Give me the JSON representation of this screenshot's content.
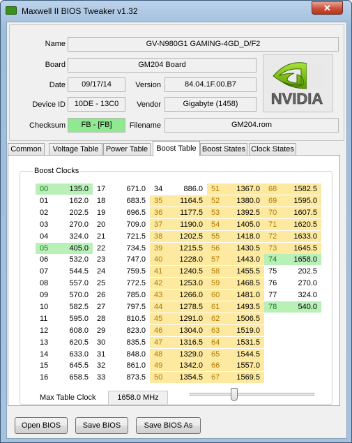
{
  "window": {
    "title": "Maxwell II BIOS Tweaker v1.32",
    "close_label": "✕"
  },
  "info": {
    "name_label": "Name",
    "name_value": "GV-N980G1 GAMING-4GD_D/F2",
    "board_label": "Board",
    "board_value": "GM204 Board",
    "date_label": "Date",
    "date_value": "09/17/14",
    "version_label": "Version",
    "version_value": "84.04.1F.00.B7",
    "device_label": "Device ID",
    "device_value": "10DE - 13C0",
    "vendor_label": "Vendor",
    "vendor_value": "Gigabyte (1458)",
    "checksum_label": "Checksum",
    "checksum_value": "FB - [FB]",
    "filename_label": "Filename",
    "filename_value": "GM204.rom",
    "logo_text": "NVIDIA",
    "colors": {
      "checksum_ok": "#90e890",
      "nvidia_green": "#76b900"
    }
  },
  "tabs": [
    {
      "label": "Common"
    },
    {
      "label": "Voltage Table"
    },
    {
      "label": "Power Table"
    },
    {
      "label": "Boost Table",
      "active": true
    },
    {
      "label": "Boost States"
    },
    {
      "label": "Clock States"
    }
  ],
  "boost": {
    "group_label": "Boost Clocks",
    "columns": [
      [
        [
          "00",
          "135.0",
          "g"
        ],
        [
          "01",
          "162.0",
          ""
        ],
        [
          "02",
          "202.5",
          ""
        ],
        [
          "03",
          "270.0",
          ""
        ],
        [
          "04",
          "324.0",
          ""
        ],
        [
          "05",
          "405.0",
          "g"
        ],
        [
          "06",
          "532.0",
          ""
        ],
        [
          "07",
          "544.5",
          ""
        ],
        [
          "08",
          "557.0",
          ""
        ],
        [
          "09",
          "570.0",
          ""
        ],
        [
          "10",
          "582.5",
          ""
        ],
        [
          "11",
          "595.0",
          ""
        ],
        [
          "12",
          "608.0",
          ""
        ],
        [
          "13",
          "620.5",
          ""
        ],
        [
          "14",
          "633.0",
          ""
        ],
        [
          "15",
          "645.5",
          ""
        ],
        [
          "16",
          "658.5",
          ""
        ]
      ],
      [
        [
          "17",
          "671.0",
          ""
        ],
        [
          "18",
          "683.5",
          ""
        ],
        [
          "19",
          "696.5",
          ""
        ],
        [
          "20",
          "709.0",
          ""
        ],
        [
          "21",
          "721.5",
          ""
        ],
        [
          "22",
          "734.5",
          ""
        ],
        [
          "23",
          "747.0",
          ""
        ],
        [
          "24",
          "759.5",
          ""
        ],
        [
          "25",
          "772.5",
          ""
        ],
        [
          "26",
          "785.0",
          ""
        ],
        [
          "27",
          "797.5",
          ""
        ],
        [
          "28",
          "810.5",
          ""
        ],
        [
          "29",
          "823.0",
          ""
        ],
        [
          "30",
          "835.5",
          ""
        ],
        [
          "31",
          "848.0",
          ""
        ],
        [
          "32",
          "861.0",
          ""
        ],
        [
          "33",
          "873.5",
          ""
        ]
      ],
      [
        [
          "34",
          "886.0",
          ""
        ],
        [
          "35",
          "1164.5",
          "y"
        ],
        [
          "36",
          "1177.5",
          "y"
        ],
        [
          "37",
          "1190.0",
          "y"
        ],
        [
          "38",
          "1202.5",
          "y"
        ],
        [
          "39",
          "1215.5",
          "y"
        ],
        [
          "40",
          "1228.0",
          "y"
        ],
        [
          "41",
          "1240.5",
          "y"
        ],
        [
          "42",
          "1253.0",
          "y"
        ],
        [
          "43",
          "1266.0",
          "y"
        ],
        [
          "44",
          "1278.5",
          "y"
        ],
        [
          "45",
          "1291.0",
          "y"
        ],
        [
          "46",
          "1304.0",
          "y"
        ],
        [
          "47",
          "1316.5",
          "y"
        ],
        [
          "48",
          "1329.0",
          "y"
        ],
        [
          "49",
          "1342.0",
          "y"
        ],
        [
          "50",
          "1354.5",
          "y"
        ]
      ],
      [
        [
          "51",
          "1367.0",
          "y"
        ],
        [
          "52",
          "1380.0",
          "y"
        ],
        [
          "53",
          "1392.5",
          "y"
        ],
        [
          "54",
          "1405.0",
          "y"
        ],
        [
          "55",
          "1418.0",
          "y"
        ],
        [
          "56",
          "1430.5",
          "y"
        ],
        [
          "57",
          "1443.0",
          "y"
        ],
        [
          "58",
          "1455.5",
          "y"
        ],
        [
          "59",
          "1468.5",
          "y"
        ],
        [
          "60",
          "1481.0",
          "y"
        ],
        [
          "61",
          "1493.5",
          "y"
        ],
        [
          "62",
          "1506.5",
          "y"
        ],
        [
          "63",
          "1519.0",
          "y"
        ],
        [
          "64",
          "1531.5",
          "y"
        ],
        [
          "65",
          "1544.5",
          "y"
        ],
        [
          "66",
          "1557.0",
          "y"
        ],
        [
          "67",
          "1569.5",
          "y"
        ]
      ],
      [
        [
          "68",
          "1582.5",
          "y"
        ],
        [
          "69",
          "1595.0",
          "y"
        ],
        [
          "70",
          "1607.5",
          "y"
        ],
        [
          "71",
          "1620.5",
          "y"
        ],
        [
          "72",
          "1633.0",
          "y"
        ],
        [
          "73",
          "1645.5",
          "y"
        ],
        [
          "74",
          "1658.0",
          "g"
        ],
        [
          "75",
          "202.5",
          ""
        ],
        [
          "76",
          "270.0",
          ""
        ],
        [
          "77",
          "324.0",
          ""
        ],
        [
          "78",
          "540.0",
          "g"
        ]
      ]
    ],
    "max_label": "Max Table Clock",
    "max_value": "1658.0 MHz"
  },
  "buttons": {
    "open": "Open BIOS",
    "save": "Save BIOS",
    "save_as": "Save BIOS As"
  }
}
